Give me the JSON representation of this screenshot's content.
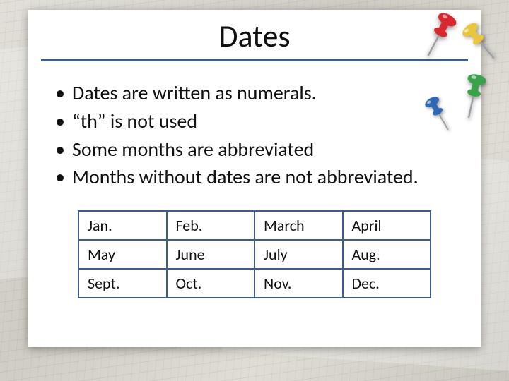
{
  "title": "Dates",
  "bullets": [
    "Dates are written as numerals.",
    "“th” is not used",
    "Some months are abbreviated",
    "Months without dates are not abbreviated."
  ],
  "months": [
    [
      "Jan.",
      "Feb.",
      "March",
      "April"
    ],
    [
      "May",
      "June",
      "July",
      "Aug."
    ],
    [
      "Sept.",
      "Oct.",
      "Nov.",
      "Dec."
    ]
  ],
  "pins": {
    "red": "#d9262f",
    "yellow": "#e9c63a",
    "green": "#3aa24a",
    "blue": "#2f69b5"
  },
  "accent": "#3b5e87"
}
